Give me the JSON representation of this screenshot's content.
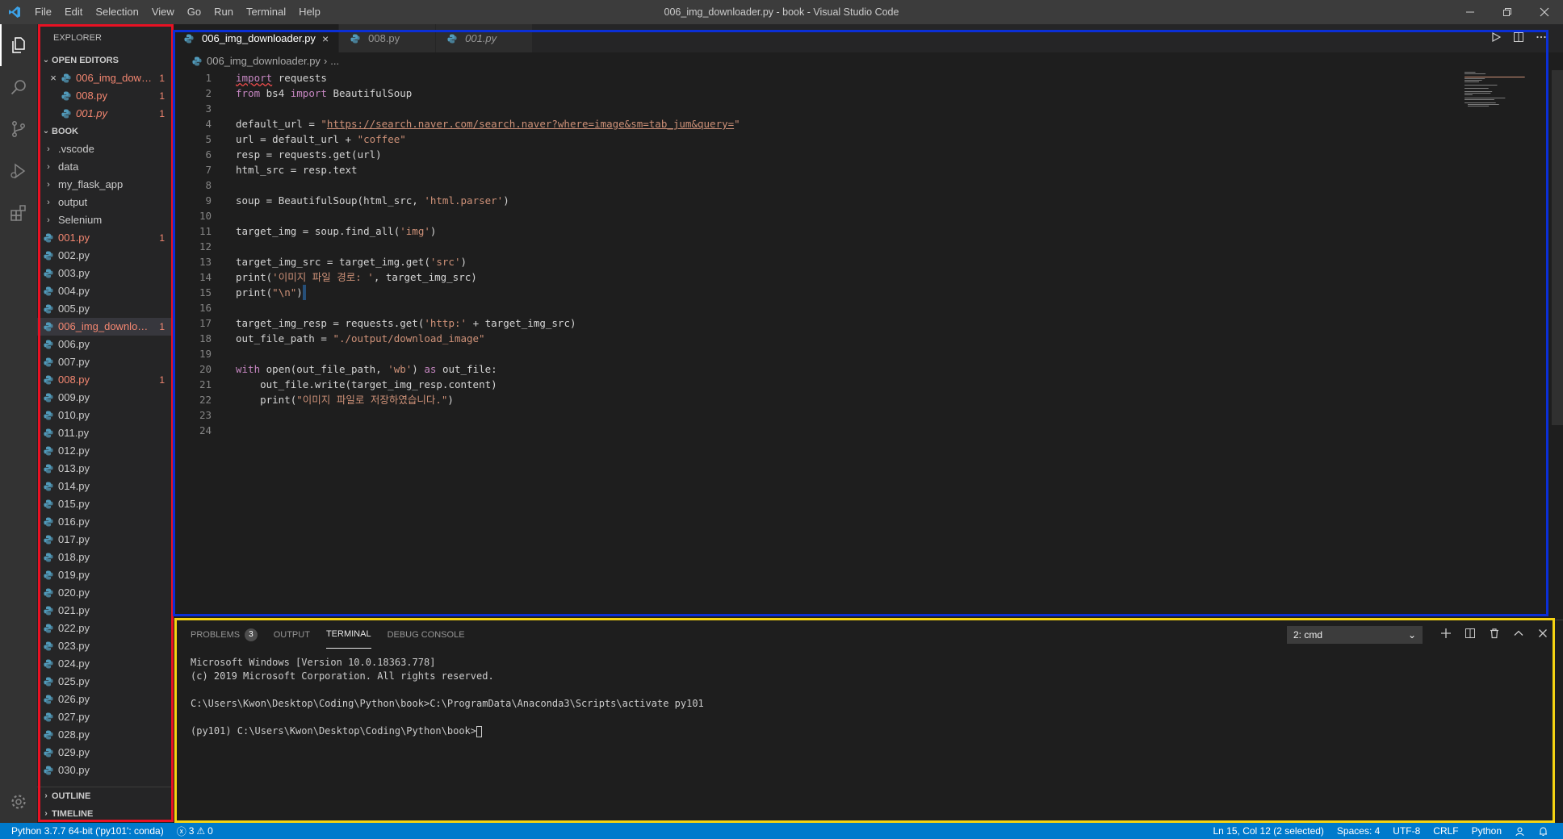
{
  "window": {
    "title": "006_img_downloader.py - book - Visual Studio Code",
    "menu": [
      "File",
      "Edit",
      "Selection",
      "View",
      "Go",
      "Run",
      "Terminal",
      "Help"
    ]
  },
  "explorer": {
    "title": "EXPLORER",
    "open_editors_label": "OPEN EDITORS",
    "open_editors": [
      {
        "name": "006_img_downloader.py",
        "badge": "1",
        "error": true,
        "italic": false,
        "active": true
      },
      {
        "name": "008.py",
        "badge": "1",
        "error": true,
        "italic": false,
        "active": false
      },
      {
        "name": "001.py",
        "badge": "1",
        "error": true,
        "italic": true,
        "active": false
      }
    ],
    "folder_label": "BOOK",
    "folders": [
      ".vscode",
      "data",
      "my_flask_app",
      "output",
      "Selenium"
    ],
    "files": [
      {
        "name": "001.py",
        "badge": "1",
        "error": true
      },
      {
        "name": "002.py"
      },
      {
        "name": "003.py"
      },
      {
        "name": "004.py"
      },
      {
        "name": "005.py"
      },
      {
        "name": "006_img_downloader.py",
        "badge": "1",
        "error": true,
        "selected": true
      },
      {
        "name": "006.py"
      },
      {
        "name": "007.py"
      },
      {
        "name": "008.py",
        "badge": "1",
        "error": true
      },
      {
        "name": "009.py"
      },
      {
        "name": "010.py"
      },
      {
        "name": "011.py"
      },
      {
        "name": "012.py"
      },
      {
        "name": "013.py"
      },
      {
        "name": "014.py"
      },
      {
        "name": "015.py"
      },
      {
        "name": "016.py"
      },
      {
        "name": "017.py"
      },
      {
        "name": "018.py"
      },
      {
        "name": "019.py"
      },
      {
        "name": "020.py"
      },
      {
        "name": "021.py"
      },
      {
        "name": "022.py"
      },
      {
        "name": "023.py"
      },
      {
        "name": "024.py"
      },
      {
        "name": "025.py"
      },
      {
        "name": "026.py"
      },
      {
        "name": "027.py"
      },
      {
        "name": "028.py"
      },
      {
        "name": "029.py"
      },
      {
        "name": "030.py"
      }
    ],
    "outline_label": "OUTLINE",
    "timeline_label": "TIMELINE"
  },
  "editor": {
    "tabs": [
      {
        "label": "006_img_downloader.py",
        "active": true,
        "italic": false
      },
      {
        "label": "008.py",
        "active": false,
        "italic": false
      },
      {
        "label": "001.py",
        "active": false,
        "italic": true
      }
    ],
    "breadcrumb": {
      "file": "006_img_downloader.py",
      "rest": "..."
    },
    "lines": [
      "import requests",
      "from bs4 import BeautifulSoup",
      "",
      "default_url = \"https://search.naver.com/search.naver?where=image&sm=tab_jum&query=\"",
      "url = default_url + \"coffee\"",
      "resp = requests.get(url)",
      "html_src = resp.text",
      "",
      "soup = BeautifulSoup(html_src, 'html.parser')",
      "",
      "target_img = soup.find_all('img')",
      "",
      "target_img_src = target_img.get('src')",
      "print('이미지 파일 경로: ', target_img_src)",
      "print(\"\\n\")",
      "",
      "target_img_resp = requests.get('http:' + target_img_src)",
      "out_file_path = \"./output/download_image\"",
      "",
      "with open(out_file_path, 'wb') as out_file:",
      "    out_file.write(target_img_resp.content)",
      "    print(\"이미지 파일로 저장하였습니다.\")",
      "",
      ""
    ]
  },
  "panel": {
    "tabs": [
      {
        "label": "PROBLEMS",
        "count": "3",
        "active": false
      },
      {
        "label": "OUTPUT",
        "active": false
      },
      {
        "label": "TERMINAL",
        "active": true
      },
      {
        "label": "DEBUG CONSOLE",
        "active": false
      }
    ],
    "terminal_select": "2: cmd",
    "terminal_lines": [
      "Microsoft Windows [Version 10.0.18363.778]",
      "(c) 2019 Microsoft Corporation. All rights reserved.",
      "",
      "C:\\Users\\Kwon\\Desktop\\Coding\\Python\\book>C:\\ProgramData\\Anaconda3\\Scripts\\activate py101",
      "",
      "(py101) C:\\Users\\Kwon\\Desktop\\Coding\\Python\\book>"
    ]
  },
  "status": {
    "interpreter": "Python 3.7.7 64-bit ('py101': conda)",
    "errors": "3",
    "warnings": "0",
    "position": "Ln 15, Col 12 (2 selected)",
    "spaces": "Spaces: 4",
    "encoding": "UTF-8",
    "eol": "CRLF",
    "language": "Python"
  },
  "colors": {
    "status_bar": "#007acc",
    "error": "#f48771",
    "annotation_red": "#e81123",
    "annotation_blue": "#0b2fd6",
    "annotation_yellow": "#f5d312"
  }
}
